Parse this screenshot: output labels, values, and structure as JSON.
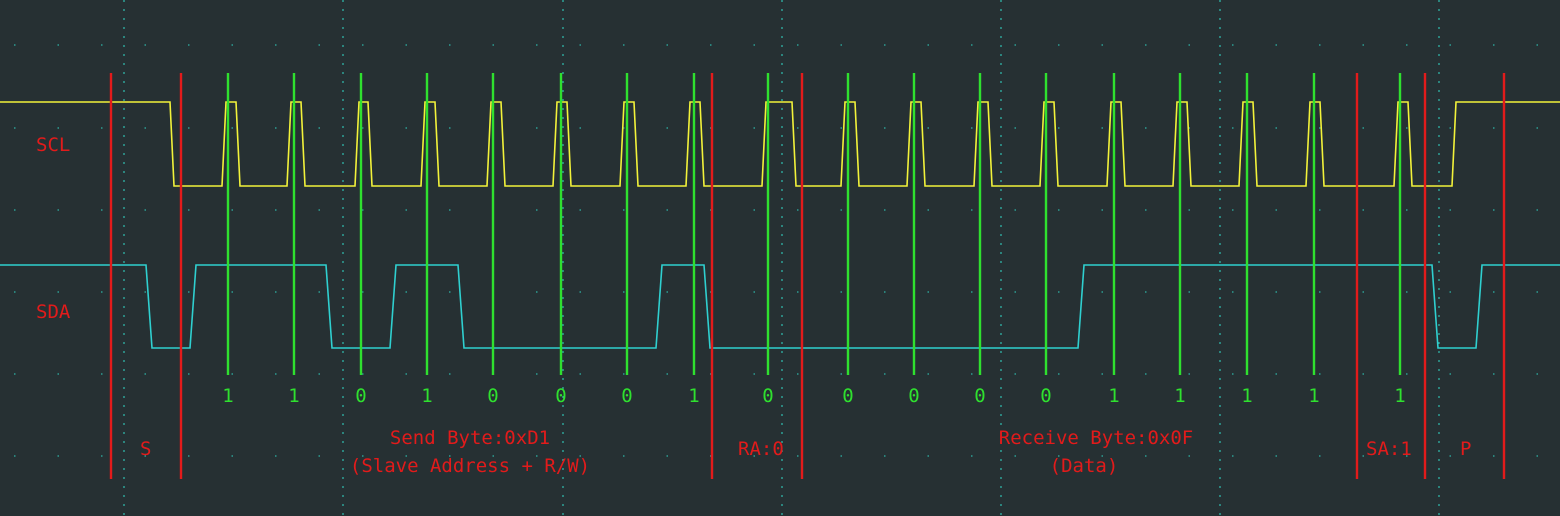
{
  "channels": {
    "scl": {
      "label": "SCL",
      "color": "#f2f23a"
    },
    "sda": {
      "label": "SDA",
      "color": "#2fd0d0"
    }
  },
  "colors": {
    "background": "#263033",
    "grid": "#2fb3a6",
    "phase_marker": "#e21b1b",
    "sample_marker": "#2fe02f",
    "label_text": "#e21b1b"
  },
  "bits": [
    "1",
    "1",
    "0",
    "1",
    "0",
    "0",
    "0",
    "1",
    "0",
    "0",
    "0",
    "0",
    "0",
    "1",
    "1",
    "1",
    "1",
    "1"
  ],
  "phases": {
    "start": "S",
    "send_byte": "Send Byte:0xD1",
    "send_desc": "(Slave Address + R/W)",
    "read_ack": "RA:0",
    "receive_byte": "Receive Byte:0x0F",
    "receive_desc": "(Data)",
    "slave_ack": "SA:1",
    "stop": "P"
  }
}
